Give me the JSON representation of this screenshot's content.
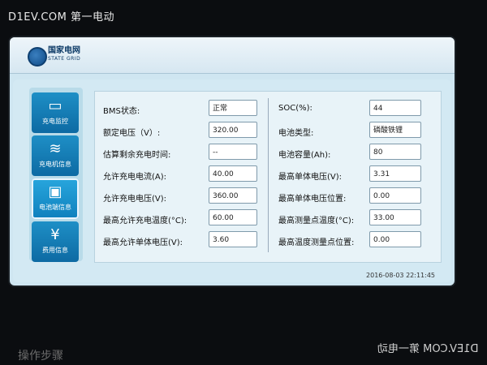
{
  "watermark": {
    "top": "D1EV.COM 第一电动",
    "bottom": "D1EV.COM 第一电动"
  },
  "bezel_text": "操作步骤",
  "brand": {
    "cn": "国家电网",
    "en": "STATE GRID"
  },
  "menu": [
    {
      "label": "充电监控",
      "icon": "plug-icon"
    },
    {
      "label": "充电机信息",
      "icon": "charger-icon"
    },
    {
      "label": "电池端信息",
      "icon": "battery-icon",
      "active": true
    },
    {
      "label": "费用信息",
      "icon": "yen-icon",
      "symbol": "¥"
    }
  ],
  "left_fields": [
    {
      "label": "BMS状态:",
      "value": "正常"
    },
    {
      "label": "额定电压（V）:",
      "value": "320.00"
    },
    {
      "label": "估算剩余充电时间:",
      "value": "--"
    },
    {
      "label": "允许充电电流(A):",
      "value": "40.00"
    },
    {
      "label": "允许充电电压(V):",
      "value": "360.00"
    },
    {
      "label": "最高允许充电温度(°C):",
      "value": "60.00"
    },
    {
      "label": "最高允许单体电压(V):",
      "value": "3.60"
    }
  ],
  "right_fields": [
    {
      "label": "SOC(%):",
      "value": "44"
    },
    {
      "label": "电池类型:",
      "value": "磷酸铁锂"
    },
    {
      "label": "电池容量(Ah):",
      "value": "80"
    },
    {
      "label": "最高单体电压(V):",
      "value": "3.31"
    },
    {
      "label": "最高单体电压位置:",
      "value": "0.00"
    },
    {
      "label": "最高测量点温度(°C):",
      "value": "33.00"
    },
    {
      "label": "最高温度测量点位置:",
      "value": "0.00"
    }
  ],
  "timestamp": "2016-08-03 22:11:45"
}
